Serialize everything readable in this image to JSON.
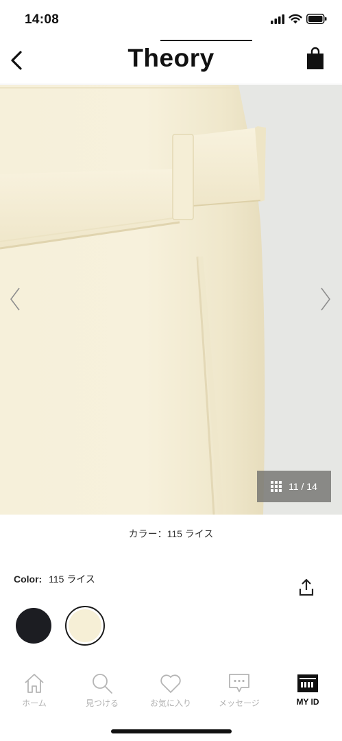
{
  "status_bar": {
    "time": "14:08",
    "icons": [
      "signal-icon",
      "wifi-icon",
      "battery-icon"
    ]
  },
  "header": {
    "brand": "Theory",
    "back_icon": "chevron-left-icon",
    "cart_icon": "shopping-bag-icon"
  },
  "gallery": {
    "counter": "11 / 14",
    "current_index": 11,
    "total": 14,
    "prev_icon": "chevron-left-icon",
    "next_icon": "chevron-right-icon",
    "grid_icon": "grid-icon",
    "fabric_color": "#f5efd6"
  },
  "product": {
    "color_caption": "カラー：115 ライス",
    "color_label": "Color:",
    "color_value": "115 ライス",
    "swatches": [
      {
        "name": "black",
        "color": "#1c1d22",
        "selected": false
      },
      {
        "name": "rice",
        "color": "#f6efd6",
        "selected": true
      }
    ],
    "share_icon": "share-icon"
  },
  "tabs": [
    {
      "label": "ホーム",
      "icon": "home-icon",
      "active": false
    },
    {
      "label": "見つける",
      "icon": "search-icon",
      "active": false
    },
    {
      "label": "お気に入り",
      "icon": "heart-icon",
      "active": false
    },
    {
      "label": "メッセージ",
      "icon": "message-icon",
      "active": false
    },
    {
      "label": "MY ID",
      "icon": "id-card-icon",
      "active": true
    }
  ]
}
